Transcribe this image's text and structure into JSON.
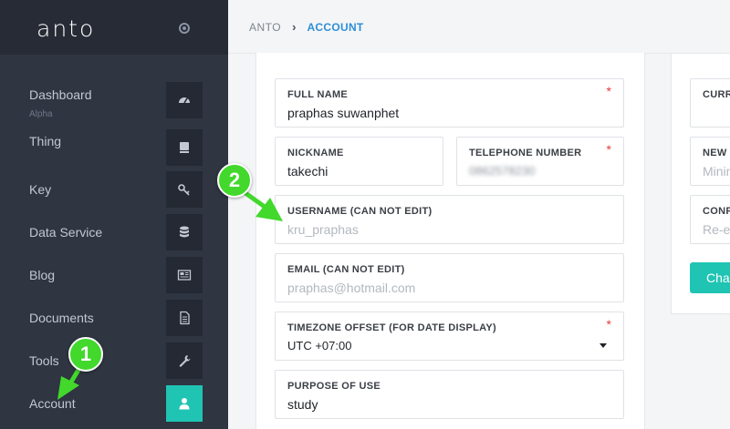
{
  "app": {
    "logo": "anto"
  },
  "breadcrumb": {
    "root": "ANTO",
    "current": "ACCOUNT"
  },
  "sidebar": {
    "items": [
      {
        "label": "Dashboard",
        "sublabel": "Alpha",
        "icon": "dashboard-gauge-icon"
      },
      {
        "label": "Thing",
        "icon": "device-icon"
      },
      {
        "label": "Key",
        "icon": "key-icon"
      },
      {
        "label": "Data Service",
        "icon": "database-icon"
      },
      {
        "label": "Blog",
        "icon": "newspaper-icon"
      },
      {
        "label": "Documents",
        "icon": "document-icon"
      },
      {
        "label": "Tools",
        "icon": "wrench-icon"
      },
      {
        "label": "Account",
        "icon": "user-icon",
        "active": true
      }
    ]
  },
  "form": {
    "full_name": {
      "label": "FULL NAME",
      "value": "praphas suwanphet",
      "required": "*"
    },
    "nickname": {
      "label": "NICKNAME",
      "value": "takechi"
    },
    "telephone": {
      "label": "TELEPHONE NUMBER",
      "value": "0862578230",
      "required": "*"
    },
    "username": {
      "label": "USERNAME (CAN NOT EDIT)",
      "value": "kru_praphas"
    },
    "email": {
      "label": "EMAIL (CAN NOT EDIT)",
      "value": "praphas@hotmail.com"
    },
    "timezone": {
      "label": "TIMEZONE OFFSET (FOR DATE DISPLAY)",
      "value": "UTC +07:00",
      "required": "*"
    },
    "purpose": {
      "label": "PURPOSE OF USE",
      "value": "study"
    }
  },
  "password_form": {
    "current_label": "CURR",
    "new_label": "NEW",
    "new_placeholder": "Minin",
    "confirm_label": "CONF",
    "confirm_placeholder": "Re-e",
    "change_button": "Cha"
  },
  "annotations": {
    "badge1": "1",
    "badge2": "2"
  },
  "colors": {
    "accent": "#20c4b3",
    "sidebar": "#2f3541",
    "link": "#2d8fd5",
    "annotation": "#42d82c",
    "required": "#e23d3d"
  }
}
